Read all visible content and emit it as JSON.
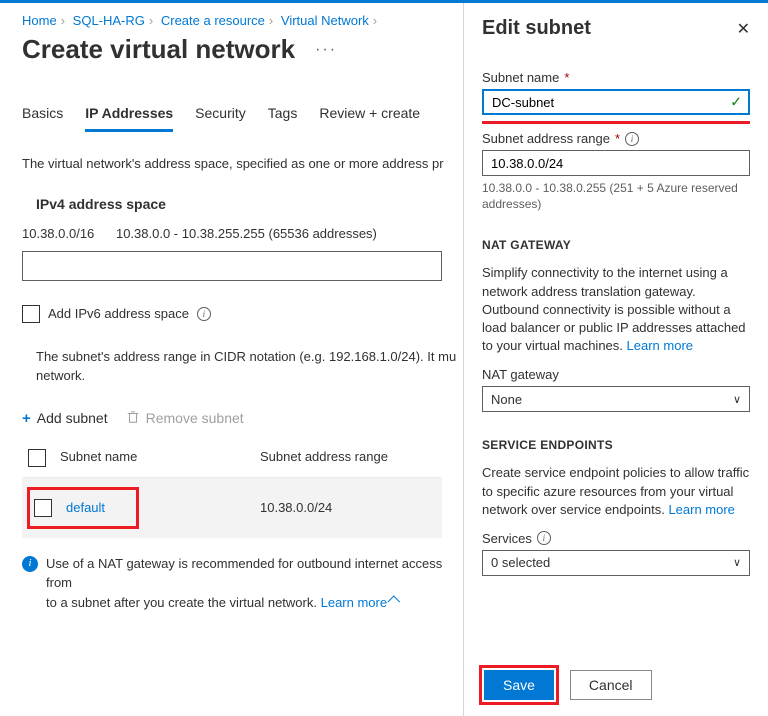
{
  "breadcrumb": {
    "home": "Home",
    "rg": "SQL-HA-RG",
    "create": "Create a resource",
    "vnet": "Virtual Network"
  },
  "page_title": "Create virtual network",
  "tabs": {
    "basics": "Basics",
    "ip": "IP Addresses",
    "security": "Security",
    "tags": "Tags",
    "review": "Review + create"
  },
  "address_desc": "The virtual network's address space, specified as one or more address pr",
  "ipv4_label": "IPv4 address space",
  "ipv4_cidr": "10.38.0.0/16",
  "ipv4_range_desc": "10.38.0.0 - 10.38.255.255 (65536 addresses)",
  "ipv6_label": "Add IPv6 address space",
  "subnet_desc": "The subnet's address range in CIDR notation (e.g. 192.168.1.0/24). It mu",
  "subnet_desc2": "network.",
  "add_subnet": "Add subnet",
  "remove_subnet": "Remove subnet",
  "table_h_name": "Subnet name",
  "table_h_range": "Subnet address range",
  "table_row_name": "default",
  "table_row_range": "10.38.0.0/24",
  "note": "Use of a NAT gateway is recommended for outbound internet access from",
  "note2": "to a subnet after you create the virtual network.",
  "learn_more": "Learn more",
  "panel": {
    "title": "Edit subnet",
    "subnet_name_label": "Subnet name",
    "subnet_name_value": "DC-subnet",
    "range_label": "Subnet address range",
    "range_value": "10.38.0.0/24",
    "range_hint": "10.38.0.0 - 10.38.0.255 (251 + 5 Azure reserved addresses)",
    "nat_head": "NAT GATEWAY",
    "nat_para": "Simplify connectivity to the internet using a network address translation gateway. Outbound connectivity is possible without a load balancer or public IP addresses attached to your virtual machines.",
    "nat_label": "NAT gateway",
    "nat_value": "None",
    "se_head": "SERVICE ENDPOINTS",
    "se_para": "Create service endpoint policies to allow traffic to specific azure resources from your virtual network over service endpoints.",
    "services_label": "Services",
    "services_value": "0 selected",
    "save": "Save",
    "cancel": "Cancel"
  }
}
